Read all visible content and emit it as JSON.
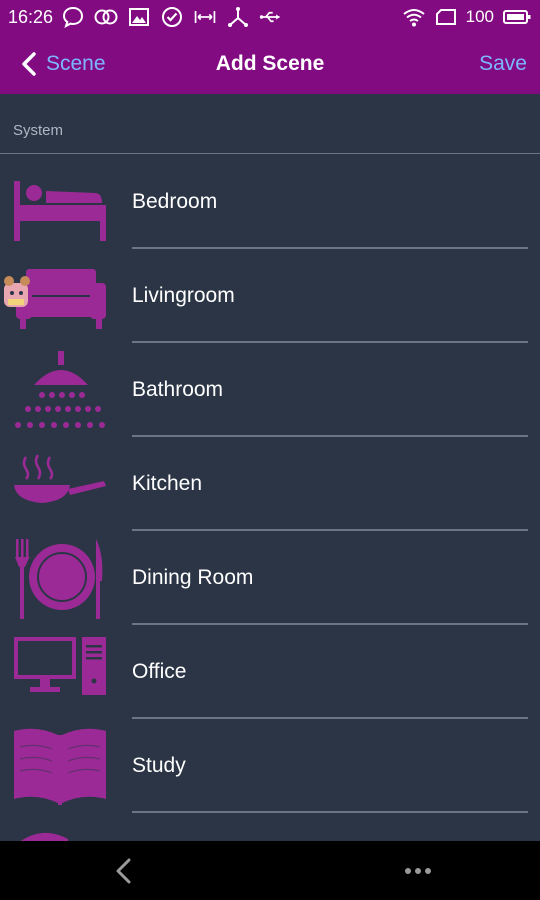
{
  "status_bar": {
    "time": "16:26",
    "battery_text": "100",
    "left_icons": [
      "chat-bubble-icon",
      "linked-circles-icon",
      "image-icon",
      "check-circle-icon",
      "bluetooth-range-icon",
      "tripod-icon",
      "usb-icon"
    ],
    "right_icons": [
      "wifi-icon",
      "sim-icon",
      "battery-icon"
    ]
  },
  "app_bar": {
    "back_label": "Scene",
    "title": "Add Scene",
    "save_label": "Save"
  },
  "section": {
    "label": "System"
  },
  "scenes": [
    {
      "label": "Bedroom",
      "icon": "bed-icon"
    },
    {
      "label": "Livingroom",
      "icon": "sofa-icon"
    },
    {
      "label": "Bathroom",
      "icon": "shower-icon"
    },
    {
      "label": "Kitchen",
      "icon": "frying-pan-icon"
    },
    {
      "label": "Dining Room",
      "icon": "plate-cutlery-icon"
    },
    {
      "label": "Office",
      "icon": "computer-icon"
    },
    {
      "label": "Study",
      "icon": "book-icon"
    },
    {
      "label": "",
      "icon": "partial-icon"
    }
  ],
  "nav_bar": {
    "icons": [
      "back-chevron-icon",
      "more-dots-icon"
    ]
  },
  "colors": {
    "accent_bar": "#820b82",
    "background": "#2b3545",
    "icon": "#9c2a96",
    "link": "#7db6ff",
    "divider": "#6c7585"
  }
}
